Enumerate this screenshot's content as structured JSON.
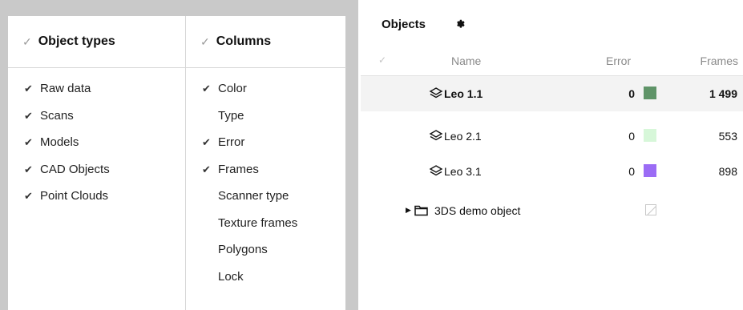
{
  "popup": {
    "object_types": {
      "header_check": "✓",
      "title": "Object types",
      "items": [
        {
          "label": "Raw data",
          "checked": true
        },
        {
          "label": "Scans",
          "checked": true
        },
        {
          "label": "Models",
          "checked": true
        },
        {
          "label": "CAD Objects",
          "checked": true
        },
        {
          "label": "Point Clouds",
          "checked": true
        }
      ]
    },
    "columns": {
      "header_check": "✓",
      "title": "Columns",
      "items": [
        {
          "label": "Color",
          "checked": true
        },
        {
          "label": "Type",
          "checked": false
        },
        {
          "label": "Error",
          "checked": true
        },
        {
          "label": "Frames",
          "checked": true
        },
        {
          "label": "Scanner type",
          "checked": false
        },
        {
          "label": "Texture frames",
          "checked": false
        },
        {
          "label": "Polygons",
          "checked": false
        },
        {
          "label": "Lock",
          "checked": false
        }
      ]
    }
  },
  "objects_panel": {
    "title": "Objects",
    "settings_icon": "gear-icon",
    "headers": {
      "check": "✓",
      "name": "Name",
      "error": "Error",
      "frames": "Frames"
    },
    "rows": [
      {
        "name": "Leo 1.1",
        "error": "0",
        "color": "#5f9468",
        "frames": "1 499",
        "selected": true
      },
      {
        "name": "Leo 2.1",
        "error": "0",
        "color": "#d7f7d9",
        "frames": "553",
        "selected": false
      },
      {
        "name": "Leo 3.1",
        "error": "0",
        "color": "#9b6cf5",
        "frames": "898",
        "selected": false
      }
    ],
    "group": {
      "name": "3DS demo object",
      "expand_icon": "caret-right-icon",
      "icon": "folder-icon"
    }
  }
}
